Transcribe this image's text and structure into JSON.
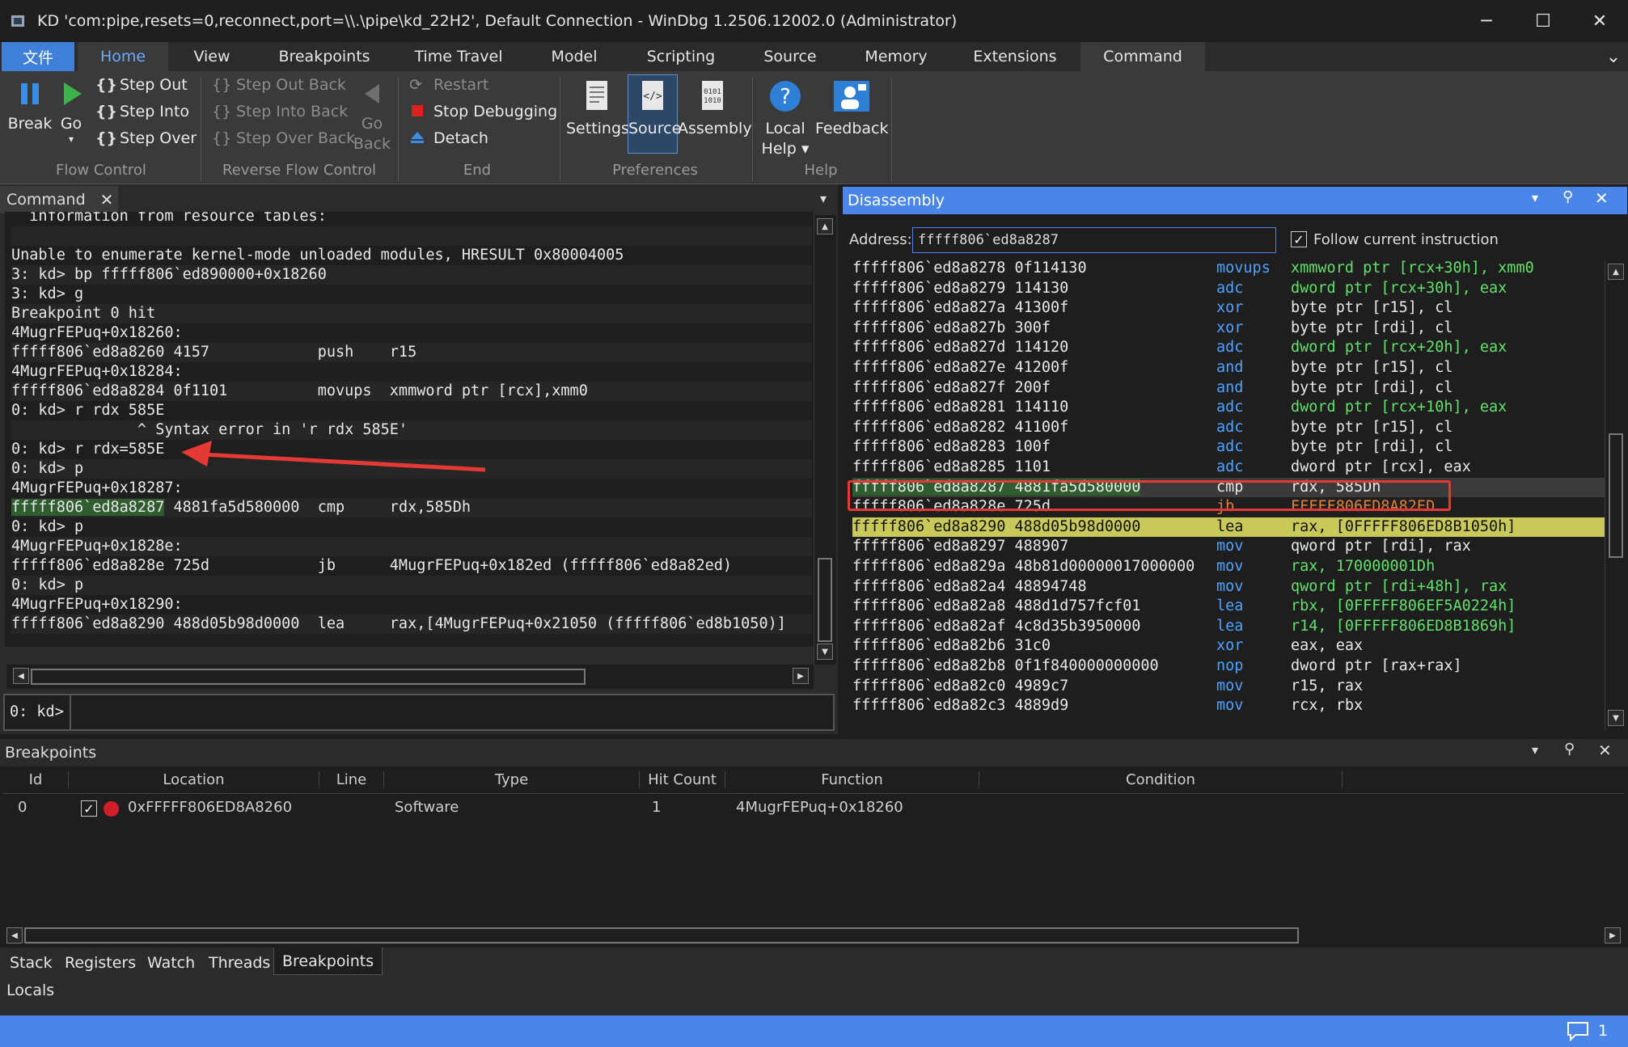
{
  "window": {
    "title": "KD 'com:pipe,resets=0,reconnect,port=\\\\.\\pipe\\kd_22H2', Default Connection  - WinDbg 1.2506.12002.0 (Administrator)",
    "minimize": "─",
    "maximize": "☐",
    "close": "✕"
  },
  "menu": {
    "tabs": [
      "文件",
      "Home",
      "View",
      "Breakpoints",
      "Time Travel",
      "Model",
      "Scripting",
      "Source",
      "Memory",
      "Extensions",
      "Command"
    ],
    "collapse": "⌄"
  },
  "ribbon": {
    "flow": {
      "break": "Break",
      "go": "Go",
      "step_out": "Step Out",
      "step_into": "Step Into",
      "step_over": "Step Over",
      "group": "Flow Control"
    },
    "reverse": {
      "step_out_back": "Step Out Back",
      "step_into_back": "Step Into Back",
      "step_over_back": "Step Over Back",
      "go_back_1": "Go",
      "go_back_2": "Back",
      "group": "Reverse Flow Control"
    },
    "end": {
      "restart": "Restart",
      "stop": "Stop Debugging",
      "detach": "Detach",
      "group": "End"
    },
    "prefs": {
      "settings": "Settings",
      "source": "Source",
      "assembly": "Assembly",
      "group": "Preferences"
    },
    "help": {
      "local_help_1": "Local",
      "local_help_2": "Help ▾",
      "feedback": "Feedback",
      "group": "Help"
    }
  },
  "command": {
    "title": "Command",
    "lines": [
      "  information from resource tables:",
      "",
      "Unable to enumerate kernel-mode unloaded modules, HRESULT 0x80004005",
      "3: kd> bp fffff806`ed890000+0x18260",
      "3: kd> g",
      "Breakpoint 0 hit",
      "4MugrFEPuq+0x18260:",
      "fffff806`ed8a8260 4157            push    r15",
      "4MugrFEPuq+0x18284:",
      "fffff806`ed8a8284 0f1101          movups  xmmword ptr [rcx],xmm0",
      "0: kd> r rdx 585E",
      "              ^ Syntax error in 'r rdx 585E'",
      "0: kd> r rdx=585E",
      "0: kd> p",
      "4MugrFEPuq+0x18287:",
      "",
      "0: kd> p",
      "4MugrFEPuq+0x1828e:",
      "fffff806`ed8a828e 725d            jb      4MugrFEPuq+0x182ed (fffff806`ed8a82ed)",
      "0: kd> p",
      "4MugrFEPuq+0x18290:",
      "fffff806`ed8a8290 488d05b98d0000  lea     rax,[4MugrFEPuq+0x21050 (fffff806`ed8b1050)]"
    ],
    "hl_addr": "fffff806`ed8a8287",
    "hl_rest": " 4881fa5d580000  cmp     rdx,585Dh",
    "prompt": "0: kd>",
    "input": ""
  },
  "disassembly": {
    "title": "Disassembly",
    "address_label": "Address:",
    "address": "fffff806`ed8a8287",
    "follow_label": "Follow current instruction",
    "follow_checked": true,
    "rows": [
      {
        "a": "fffff806`ed8a8278 0f114130",
        "op": "movups",
        "arg": "xmmword ptr [rcx+30h], xmm0"
      },
      {
        "a": "fffff806`ed8a8279 114130",
        "op": "adc",
        "arg": "dword ptr [rcx+30h], eax"
      },
      {
        "a": "fffff806`ed8a827a 41300f",
        "op": "xor",
        "arg": "byte ptr [r15], cl"
      },
      {
        "a": "fffff806`ed8a827b 300f",
        "op": "xor",
        "arg": "byte ptr [rdi], cl"
      },
      {
        "a": "fffff806`ed8a827d 114120",
        "op": "adc",
        "arg": "dword ptr [rcx+20h], eax"
      },
      {
        "a": "fffff806`ed8a827e 41200f",
        "op": "and",
        "arg": "byte ptr [r15], cl"
      },
      {
        "a": "fffff806`ed8a827f 200f",
        "op": "and",
        "arg": "byte ptr [rdi], cl"
      },
      {
        "a": "fffff806`ed8a8281 114110",
        "op": "adc",
        "arg": "dword ptr [rcx+10h], eax"
      },
      {
        "a": "fffff806`ed8a8282 41100f",
        "op": "adc",
        "arg": "byte ptr [r15], cl"
      },
      {
        "a": "fffff806`ed8a8283 100f",
        "op": "adc",
        "arg": "byte ptr [rdi], cl"
      },
      {
        "a": "fffff806`ed8a8285 1101",
        "op": "adc",
        "arg": "dword ptr [rcx], eax"
      },
      {
        "a": "fffff806`ed8a8287 4881fa5d580000",
        "op": "cmp",
        "arg": "rdx, 585Dh"
      },
      {
        "a": "fffff806`ed8a828e 725d",
        "op": "jb",
        "arg": "FFFFF806ED8A82ED"
      },
      {
        "a": "fffff806`ed8a8290 488d05b98d0000",
        "op": "lea",
        "arg": "rax, [0FFFFF806ED8B1050h]"
      },
      {
        "a": "fffff806`ed8a8297 488907",
        "op": "mov",
        "arg": "qword ptr [rdi], rax"
      },
      {
        "a": "fffff806`ed8a829a 48b81d00000017000000",
        "op": "mov",
        "arg": "rax, 170000001Dh"
      },
      {
        "a": "fffff806`ed8a82a4 48894748",
        "op": "mov",
        "arg": "qword ptr [rdi+48h], rax"
      },
      {
        "a": "fffff806`ed8a82a8 488d1d757fcf01",
        "op": "lea",
        "arg": "rbx, [0FFFFF806EF5A0224h]"
      },
      {
        "a": "fffff806`ed8a82af 4c8d35b3950000",
        "op": "lea",
        "arg": "r14, [0FFFFF806ED8B1869h]"
      },
      {
        "a": "fffff806`ed8a82b6 31c0",
        "op": "xor",
        "arg": "eax, eax"
      },
      {
        "a": "fffff806`ed8a82b8 0f1f840000000000",
        "op": "nop",
        "arg": "dword ptr [rax+rax]"
      },
      {
        "a": "fffff806`ed8a82c0 4989c7",
        "op": "mov",
        "arg": "r15, rax"
      },
      {
        "a": "fffff806`ed8a82c3 4889d9",
        "op": "mov",
        "arg": "rcx, rbx"
      }
    ]
  },
  "breakpoints": {
    "title": "Breakpoints",
    "columns": [
      "Id",
      "Location",
      "Line",
      "Type",
      "Hit Count",
      "Function",
      "Condition"
    ],
    "rows": [
      {
        "id": "0",
        "location": "0xFFFFF806ED8A8260",
        "line": "",
        "type": "Software",
        "hits": "1",
        "function": "4MugrFEPuq+0x18260",
        "condition": "",
        "enabled": true
      }
    ]
  },
  "bottom_tabs": [
    "Stack",
    "Registers",
    "Watch",
    "Threads",
    "Breakpoints"
  ],
  "bottom_tabs2": [
    "Locals"
  ],
  "status": {
    "notifications": "1"
  },
  "colors": {
    "accent": "#4a86e8",
    "highlight_current": "#c9c95a",
    "highlight_bp": "#2f5d2f",
    "annotation_red": "#e53935"
  }
}
